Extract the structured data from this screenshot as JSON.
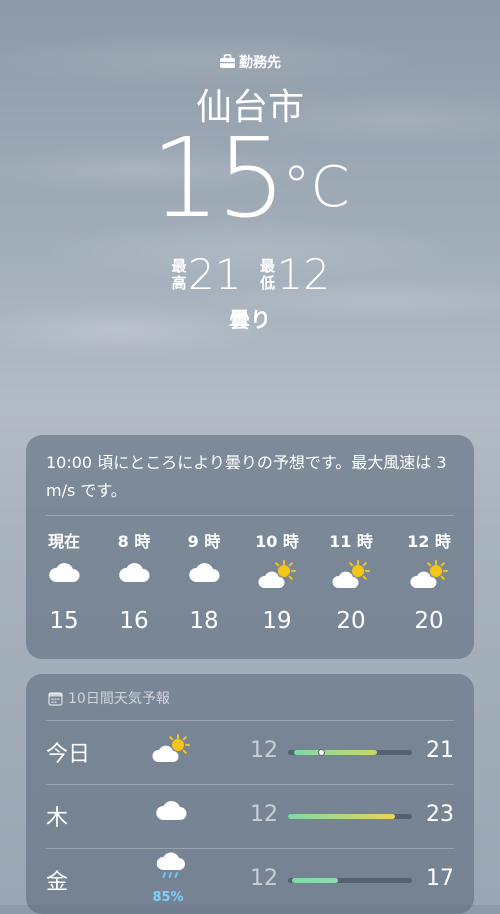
{
  "location": {
    "tag": "勤務先",
    "city": "仙台市",
    "temperature": "15",
    "unit": "°C",
    "high_label": "最高",
    "high": "21",
    "low_label": "最低",
    "low": "12",
    "condition": "曇り"
  },
  "hourly_card": {
    "summary": "10:00 頃にところにより曇りの予想です。最大風速は 3 m/s です。",
    "hours": [
      {
        "time": "現在",
        "icon": "cloud-icon",
        "temp": "15"
      },
      {
        "time": "8 時",
        "icon": "cloud-icon",
        "temp": "16"
      },
      {
        "time": "9 時",
        "icon": "cloud-icon",
        "temp": "18"
      },
      {
        "time": "10 時",
        "icon": "partly-sunny-icon",
        "temp": "19"
      },
      {
        "time": "11 時",
        "icon": "partly-sunny-icon",
        "temp": "20"
      },
      {
        "time": "12 時",
        "icon": "partly-sunny-icon",
        "temp": "20"
      }
    ]
  },
  "forecast_card": {
    "title": "10日間天気予報",
    "days": [
      {
        "day": "今日",
        "icon": "partly-sunny-icon",
        "low": "12",
        "high": "21",
        "range_start": 0.05,
        "range_end": 0.72,
        "current": 0.27,
        "colors": [
          "#7fd8a8",
          "#c8d86a"
        ]
      },
      {
        "day": "木",
        "icon": "cloud-icon",
        "low": "12",
        "high": "23",
        "range_start": 0.0,
        "range_end": 0.86,
        "colors": [
          "#7fd8a8",
          "#e8d65a"
        ]
      },
      {
        "day": "金",
        "icon": "rain-icon",
        "precip": "85%",
        "low": "12",
        "high": "17",
        "range_start": 0.03,
        "range_end": 0.4,
        "colors": [
          "#7fd8a8",
          "#8fdcb0"
        ]
      }
    ]
  }
}
